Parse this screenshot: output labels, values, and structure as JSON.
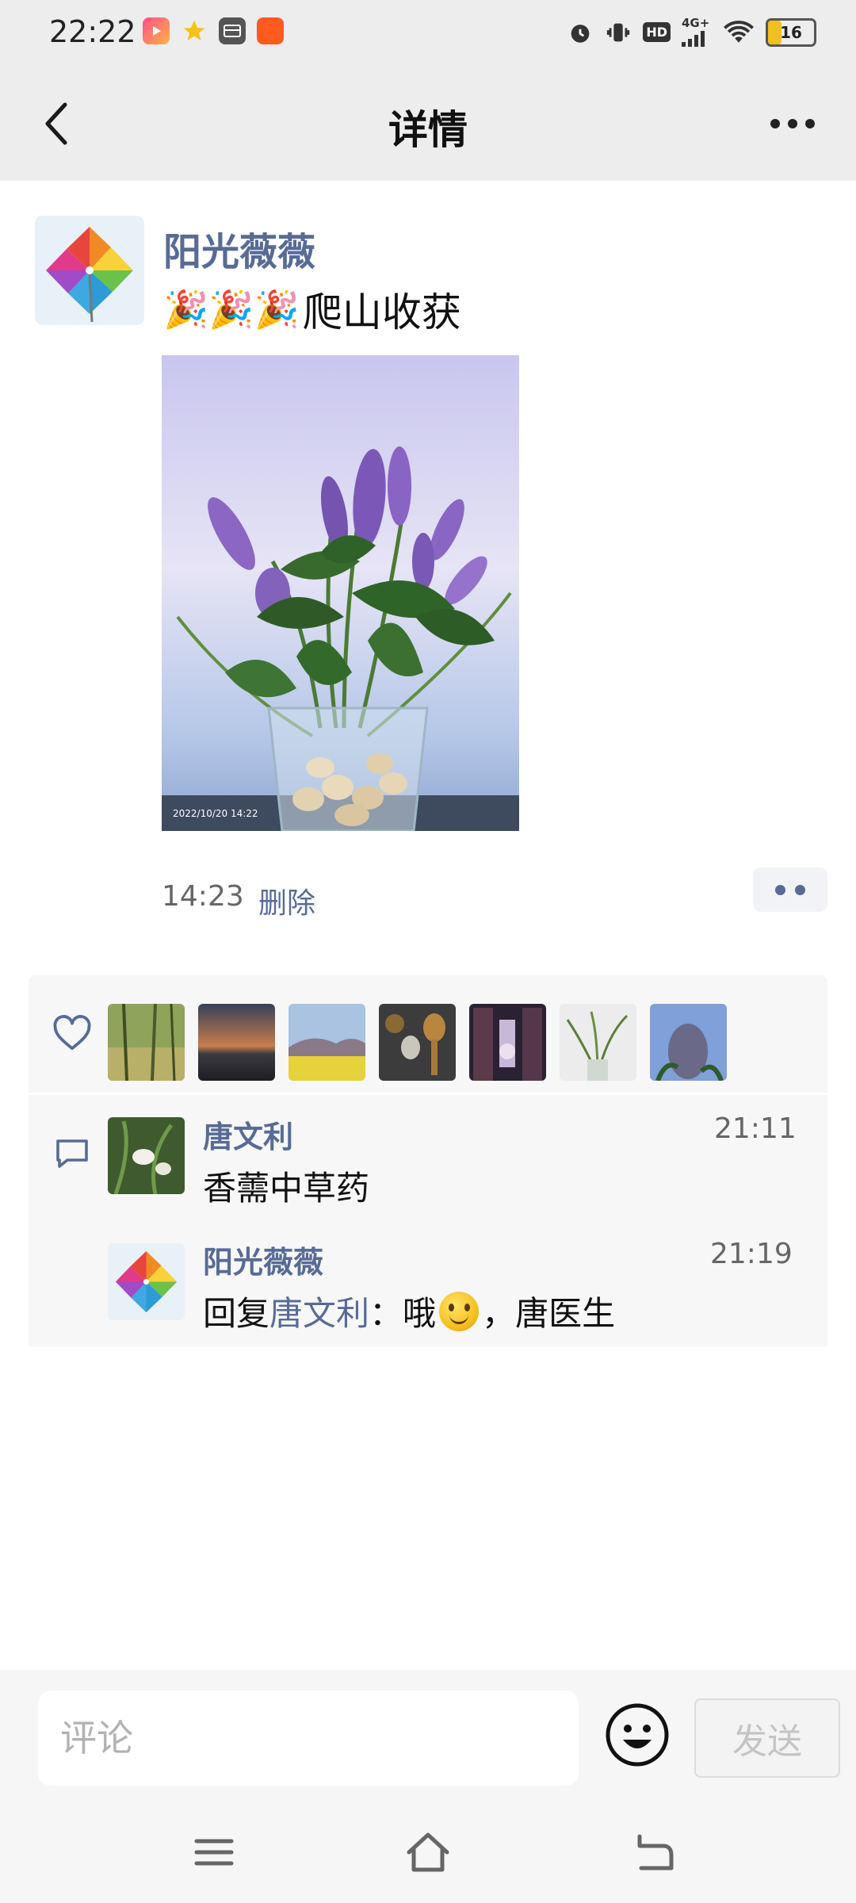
{
  "status_bar": {
    "time": "22:22",
    "battery": "16",
    "network": "4G+",
    "hd": "HD"
  },
  "header": {
    "title": "详情",
    "back_icon": "chevron-left-icon",
    "more_icon": "more-dots-icon"
  },
  "post": {
    "author": "阳光薇薇",
    "emoji_prefix": "🎉🎉🎉",
    "text": "爬山收获",
    "photo_timestamp": "2022/10/20 14:22",
    "time": "14:23",
    "delete_label": "删除"
  },
  "likes": {
    "icon": "heart-icon",
    "count": 7
  },
  "comments": [
    {
      "author": "唐文利",
      "time": "21:11",
      "text": "香薷中草药"
    },
    {
      "author": "阳光薇薇",
      "time": "21:19",
      "reply_prefix": "回复",
      "reply_to": "唐文利",
      "colon": "：",
      "text_before_emoji": "哦",
      "text_after_emoji": "，唐医生"
    }
  ],
  "input_bar": {
    "placeholder": "评论",
    "send_label": "发送"
  },
  "colors": {
    "link_blue": "#576b95",
    "background_gray": "#ededed"
  }
}
